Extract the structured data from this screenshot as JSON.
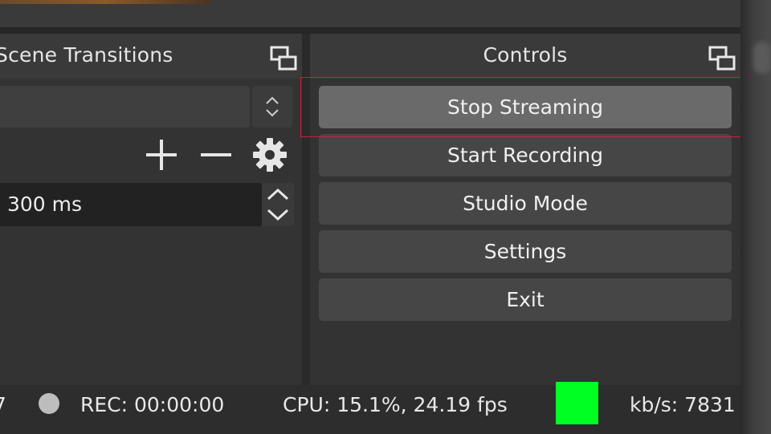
{
  "scene_transitions": {
    "title": "Scene Transitions",
    "duration_value": "300 ms"
  },
  "controls": {
    "title": "Controls",
    "buttons": [
      {
        "label": "Stop Streaming",
        "active": true
      },
      {
        "label": "Start Recording",
        "active": false
      },
      {
        "label": "Studio Mode",
        "active": false
      },
      {
        "label": "Settings",
        "active": false
      },
      {
        "label": "Exit",
        "active": false
      }
    ]
  },
  "status_bar": {
    "dropped_frames_fragment": "7",
    "rec_time": "REC: 00:00:00",
    "cpu": "CPU: 15.1%, 24.19 fps",
    "kbs": "kb/s: 7831",
    "stream_indicator_color": "#00ff22"
  },
  "colors": {
    "highlight": "#c8203a"
  }
}
